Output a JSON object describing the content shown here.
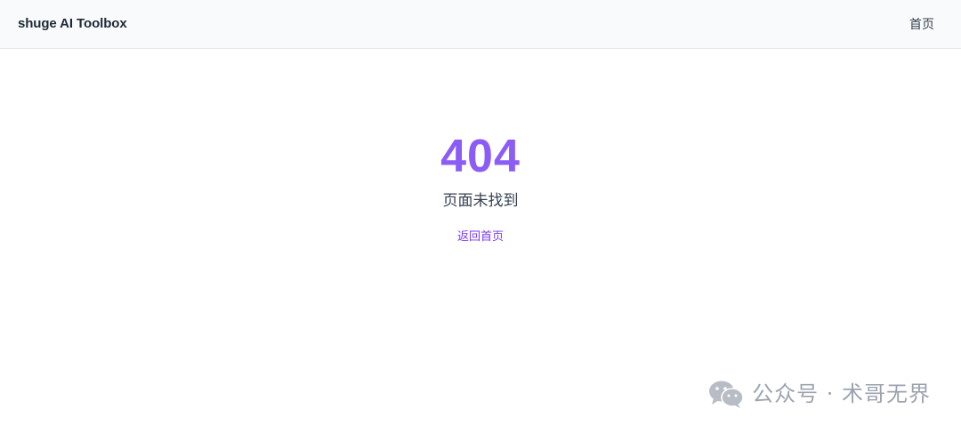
{
  "navbar": {
    "brand": "shuge AI Toolbox",
    "home_link": "首页"
  },
  "error": {
    "code": "404",
    "message": "页面未找到",
    "back_link": "返回首页"
  },
  "watermark": {
    "icon": "wechat-icon",
    "text": "公众号 · 术哥无界"
  },
  "colors": {
    "accent": "#8b5cf6",
    "link": "#7c3aed",
    "navbar_bg": "#f9fafb",
    "text_dark": "#1f2937",
    "watermark": "#9ca3af"
  }
}
